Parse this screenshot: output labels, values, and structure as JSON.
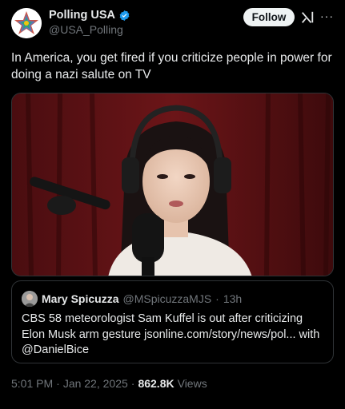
{
  "author": {
    "display_name": "Polling USA",
    "handle": "@USA_Polling",
    "verified": true
  },
  "actions": {
    "follow_label": "Follow",
    "grok_icon": "grok-icon",
    "more_icon": "more-icon"
  },
  "tweet": {
    "text": "In America, you get fired if you criticize people in power for doing a nazi salute on TV"
  },
  "quote": {
    "display_name": "Mary Spicuzza",
    "handle": "@MSpicuzzaMJS",
    "separator": "·",
    "time": "13h",
    "text": "CBS 58 meteorologist Sam Kuffel is out after criticizing Elon Musk arm gesture jsonline.com/story/news/pol... with @DanielBice"
  },
  "meta": {
    "time": "5:01 PM",
    "separator1": "·",
    "date": "Jan 22, 2025",
    "separator2": "·",
    "views_count": "862.8K",
    "views_label": "Views"
  },
  "colors": {
    "background": "#000000",
    "text": "#e7e9ea",
    "secondary": "#71767b",
    "verified": "#1d9bf0",
    "border": "#2f3336"
  }
}
